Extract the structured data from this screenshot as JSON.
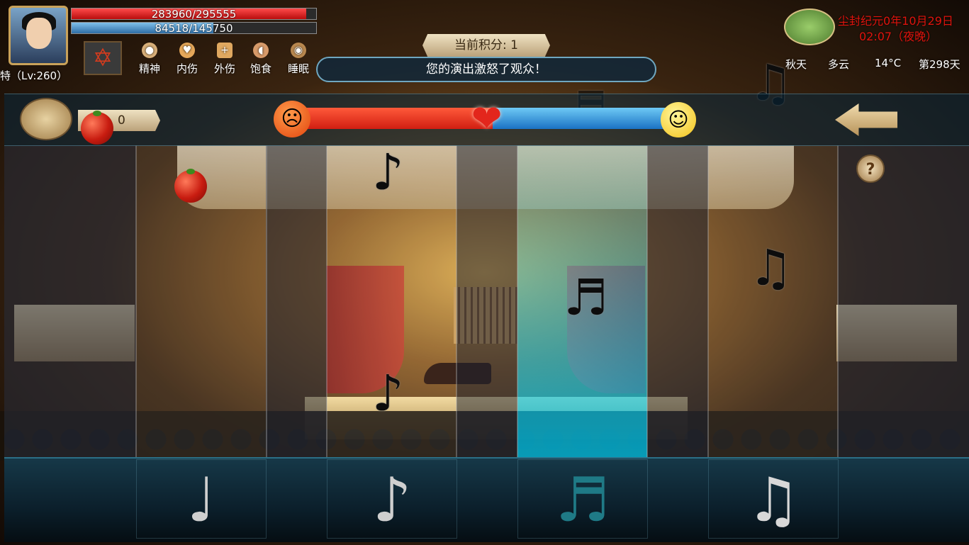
{
  "player": {
    "hp_text": "283960/295555",
    "hp_fraction": 0.96,
    "mp_text": "84518/145750",
    "mp_fraction": 0.58,
    "level_text": "特（Lv:260）"
  },
  "stats": [
    {
      "icon": "brain-icon",
      "label": "精神"
    },
    {
      "icon": "heart-icon",
      "label": "内伤"
    },
    {
      "icon": "medkit-icon",
      "label": "外伤"
    },
    {
      "icon": "stomach-icon",
      "label": "饱食"
    },
    {
      "icon": "sleep-icon",
      "label": "睡眠"
    }
  ],
  "score": {
    "label": "当前积分: 1"
  },
  "message": "您的演出激怒了观众！",
  "datetime": {
    "date": "尘封纪元0年10月29日",
    "time": "02:07（夜晚）"
  },
  "weather": {
    "season": "秋天",
    "sky": "多云",
    "temp": "14°C",
    "day": "第298天"
  },
  "tomatoes": {
    "count": "0"
  },
  "mood": {
    "fraction": 0.52,
    "colors": {
      "angry": "#d11e12",
      "happy": "#1a72c4"
    }
  },
  "help_label": "?",
  "icons": {
    "quarter": "♩",
    "eighth": "♪",
    "beamed": "♫",
    "sixteenth": "♬"
  }
}
